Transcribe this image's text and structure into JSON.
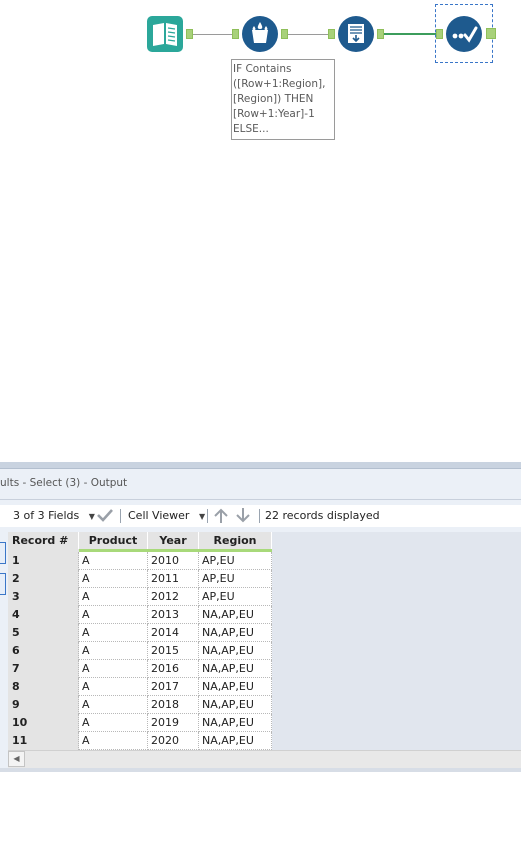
{
  "canvas": {
    "formula_note": "IF Contains\n([Row+1:Region],\n[Region]) THEN\n[Row+1:Year]-1\nELSE...",
    "colors": {
      "input_tool": "#2ba79a",
      "blue_tool": "#1e5a8e",
      "connector_active": "#3c9d5c",
      "anchor": "#a8d17a"
    },
    "tools": [
      {
        "icon": "book-icon"
      },
      {
        "icon": "multi-row-formula-icon"
      },
      {
        "icon": "append-icon"
      },
      {
        "icon": "select-icon"
      }
    ]
  },
  "results": {
    "title": "ults - Select (3) - Output",
    "fields_label": "3 of 3 Fields",
    "cell_viewer_label": "Cell Viewer",
    "records_label": "22 records displayed",
    "columns": [
      "Record #",
      "Product",
      "Year",
      "Region"
    ],
    "rows": [
      [
        "1",
        "A",
        "2010",
        "AP,EU"
      ],
      [
        "2",
        "A",
        "2011",
        "AP,EU"
      ],
      [
        "3",
        "A",
        "2012",
        "AP,EU"
      ],
      [
        "4",
        "A",
        "2013",
        "NA,AP,EU"
      ],
      [
        "5",
        "A",
        "2014",
        "NA,AP,EU"
      ],
      [
        "6",
        "A",
        "2015",
        "NA,AP,EU"
      ],
      [
        "7",
        "A",
        "2016",
        "NA,AP,EU"
      ],
      [
        "8",
        "A",
        "2017",
        "NA,AP,EU"
      ],
      [
        "9",
        "A",
        "2018",
        "NA,AP,EU"
      ],
      [
        "10",
        "A",
        "2019",
        "NA,AP,EU"
      ],
      [
        "11",
        "A",
        "2020",
        "NA,AP,EU"
      ]
    ]
  }
}
